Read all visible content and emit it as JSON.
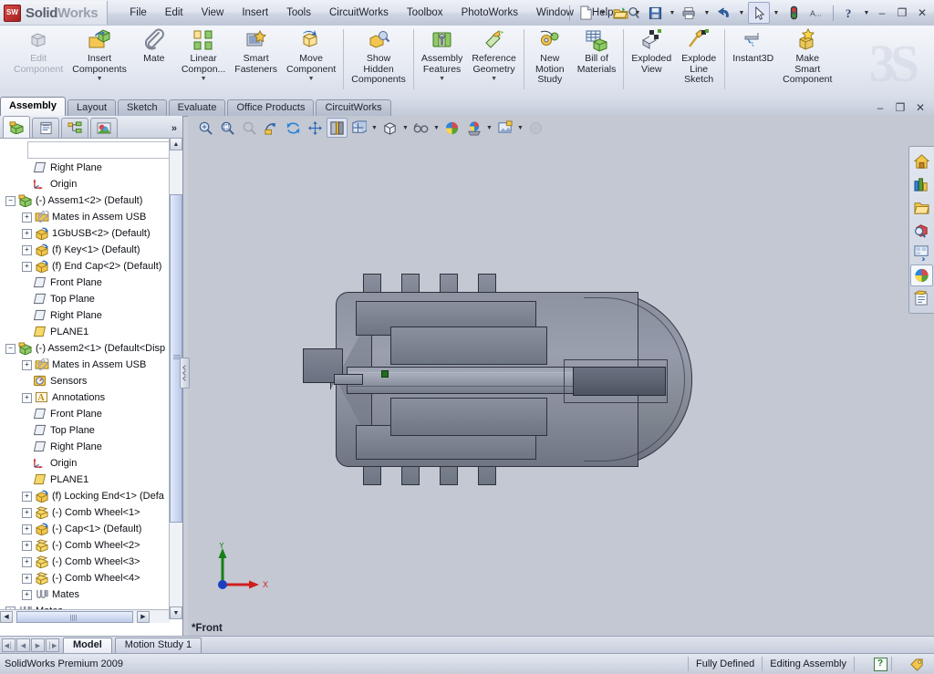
{
  "app": {
    "brand_bold": "Solid",
    "brand_light": "Works",
    "logo_glyph": "SW",
    "premium_label": "SolidWorks Premium 2009",
    "accent": "#c34040",
    "viewport_bg": "#c3c8d2"
  },
  "menu": {
    "items": [
      {
        "label": "File"
      },
      {
        "label": "Edit"
      },
      {
        "label": "View"
      },
      {
        "label": "Insert"
      },
      {
        "label": "Tools"
      },
      {
        "label": "CircuitWorks"
      },
      {
        "label": "Toolbox"
      },
      {
        "label": "PhotoWorks"
      },
      {
        "label": "Window"
      },
      {
        "label": "Help"
      }
    ],
    "search_icon": "magnifier-icon"
  },
  "quick_toolbar": {
    "buttons": [
      {
        "name": "new-document-button",
        "icon": "new-document-icon",
        "dropdown": true
      },
      {
        "name": "open-document-button",
        "icon": "open-folder-icon",
        "dropdown": true
      },
      {
        "name": "save-button",
        "icon": "floppy-disk-icon",
        "dropdown": true
      },
      {
        "name": "print-button",
        "icon": "printer-icon",
        "dropdown": true
      },
      {
        "name": "undo-button",
        "icon": "undo-arrow-icon",
        "dropdown": true
      },
      {
        "name": "select-button",
        "icon": "cursor-arrow-icon",
        "dropdown": true,
        "selected": true
      },
      {
        "name": "rebuild-button",
        "icon": "traffic-light-icon",
        "dropdown": false
      },
      {
        "name": "options-button",
        "icon": "options-gear-icon",
        "dropdown": false
      },
      {
        "name": "help-button",
        "icon": "question-mark-icon",
        "dropdown": true
      }
    ],
    "window_buttons": [
      {
        "name": "minimize-button",
        "glyph": "–"
      },
      {
        "name": "restore-button",
        "glyph": "❐"
      },
      {
        "name": "close-button",
        "glyph": "✕"
      }
    ]
  },
  "ribbon": {
    "watermark": "3S",
    "commands": [
      {
        "label": "Edit\nComponent",
        "name": "edit-component",
        "icon": "edit-component-icon",
        "disabled": true,
        "dropdown": false
      },
      {
        "label": "Insert\nComponents",
        "name": "insert-components",
        "icon": "insert-components-icon",
        "disabled": false,
        "dropdown": true
      },
      {
        "label": "Mate",
        "name": "mate",
        "icon": "paperclip-mate-icon",
        "disabled": false,
        "dropdown": false
      },
      {
        "label": "Linear\nCompon...",
        "name": "linear-component-pattern",
        "icon": "linear-pattern-icon",
        "disabled": false,
        "dropdown": true
      },
      {
        "label": "Smart\nFasteners",
        "name": "smart-fasteners",
        "icon": "smart-fasteners-icon",
        "disabled": false,
        "dropdown": false
      },
      {
        "label": "Move\nComponent",
        "name": "move-component",
        "icon": "move-component-icon",
        "disabled": false,
        "dropdown": true
      },
      {
        "label": "Show\nHidden\nComponents",
        "name": "show-hidden-components",
        "icon": "show-hidden-icon",
        "disabled": false,
        "dropdown": false
      },
      {
        "label": "Assembly\nFeatures",
        "name": "assembly-features",
        "icon": "assembly-features-icon",
        "disabled": false,
        "dropdown": true
      },
      {
        "label": "Reference\nGeometry",
        "name": "reference-geometry",
        "icon": "reference-geometry-icon",
        "disabled": false,
        "dropdown": true
      },
      {
        "label": "New\nMotion\nStudy",
        "name": "new-motion-study",
        "icon": "motion-study-icon",
        "disabled": false,
        "dropdown": false
      },
      {
        "label": "Bill of\nMaterials",
        "name": "bill-of-materials",
        "icon": "bom-table-icon",
        "disabled": false,
        "dropdown": false
      },
      {
        "label": "Exploded\nView",
        "name": "exploded-view",
        "icon": "exploded-view-icon",
        "disabled": false,
        "dropdown": false
      },
      {
        "label": "Explode\nLine\nSketch",
        "name": "explode-line-sketch",
        "icon": "explode-line-icon",
        "disabled": false,
        "dropdown": false
      },
      {
        "label": "Instant3D",
        "name": "instant3d",
        "icon": "instant3d-icon",
        "disabled": false,
        "dropdown": false
      },
      {
        "label": "Make\nSmart\nComponent",
        "name": "make-smart-component",
        "icon": "make-smart-component-icon",
        "disabled": false,
        "dropdown": false
      }
    ]
  },
  "command_tabs": {
    "items": [
      {
        "label": "Assembly",
        "active": true
      },
      {
        "label": "Layout",
        "active": false
      },
      {
        "label": "Sketch",
        "active": false
      },
      {
        "label": "Evaluate",
        "active": false
      },
      {
        "label": "Office Products",
        "active": false
      },
      {
        "label": "CircuitWorks",
        "active": false
      }
    ]
  },
  "feature_manager": {
    "tabs": [
      {
        "name": "feature-tree-tab",
        "icon": "feature-tree-icon",
        "active": true
      },
      {
        "name": "property-manager-tab",
        "icon": "property-manager-icon",
        "active": false
      },
      {
        "name": "configuration-manager-tab",
        "icon": "configuration-manager-icon",
        "active": false
      },
      {
        "name": "display-manager-tab",
        "icon": "display-manager-icon",
        "active": false
      }
    ],
    "more_glyph": "»",
    "filter_placeholder": "",
    "tree": [
      {
        "label": "Right Plane",
        "indent": 1,
        "expand": "none",
        "icon": "plane-icon"
      },
      {
        "label": "Origin",
        "indent": 1,
        "expand": "none",
        "icon": "origin-icon"
      },
      {
        "label": "(-) Assem1<2> (Default)",
        "indent": 0,
        "expand": "minus",
        "icon": "assembly-icon"
      },
      {
        "label": "Mates in Assem USB",
        "indent": 1,
        "expand": "plus",
        "icon": "mates-folder-icon"
      },
      {
        "label": "1GbUSB<2> (Default)",
        "indent": 1,
        "expand": "plus",
        "icon": "part-icon"
      },
      {
        "label": "(f) Key<1> (Default)",
        "indent": 1,
        "expand": "plus",
        "icon": "part-icon"
      },
      {
        "label": "(f) End Cap<2> (Default)",
        "indent": 1,
        "expand": "plus",
        "icon": "part-icon"
      },
      {
        "label": "Front Plane",
        "indent": 1,
        "expand": "none",
        "icon": "plane-icon"
      },
      {
        "label": "Top Plane",
        "indent": 1,
        "expand": "none",
        "icon": "plane-icon"
      },
      {
        "label": "Right Plane",
        "indent": 1,
        "expand": "none",
        "icon": "plane-icon"
      },
      {
        "label": "PLANE1",
        "indent": 1,
        "expand": "none",
        "icon": "plane-yellow-icon"
      },
      {
        "label": "(-) Assem2<1> (Default<Disp",
        "indent": 0,
        "expand": "minus",
        "icon": "assembly-icon"
      },
      {
        "label": "Mates in Assem USB",
        "indent": 1,
        "expand": "plus",
        "icon": "mates-folder-icon"
      },
      {
        "label": "Sensors",
        "indent": 1,
        "expand": "none",
        "icon": "sensors-icon"
      },
      {
        "label": "Annotations",
        "indent": 1,
        "expand": "plus",
        "icon": "annotations-icon"
      },
      {
        "label": "Front Plane",
        "indent": 1,
        "expand": "none",
        "icon": "plane-icon"
      },
      {
        "label": "Top Plane",
        "indent": 1,
        "expand": "none",
        "icon": "plane-icon"
      },
      {
        "label": "Right Plane",
        "indent": 1,
        "expand": "none",
        "icon": "plane-icon"
      },
      {
        "label": "Origin",
        "indent": 1,
        "expand": "none",
        "icon": "origin-icon"
      },
      {
        "label": "PLANE1",
        "indent": 1,
        "expand": "none",
        "icon": "plane-yellow-icon"
      },
      {
        "label": "(f) Locking End<1> (Defa",
        "indent": 1,
        "expand": "plus",
        "icon": "part-icon"
      },
      {
        "label": "(-) Comb Wheel<1>",
        "indent": 1,
        "expand": "plus",
        "icon": "part-yellow-icon"
      },
      {
        "label": "(-) Cap<1> (Default)",
        "indent": 1,
        "expand": "plus",
        "icon": "part-icon"
      },
      {
        "label": "(-) Comb Wheel<2>",
        "indent": 1,
        "expand": "plus",
        "icon": "part-yellow-icon"
      },
      {
        "label": "(-) Comb Wheel<3>",
        "indent": 1,
        "expand": "plus",
        "icon": "part-yellow-icon"
      },
      {
        "label": "(-) Comb Wheel<4>",
        "indent": 1,
        "expand": "plus",
        "icon": "part-yellow-icon"
      },
      {
        "label": "Mates",
        "indent": 1,
        "expand": "plus",
        "icon": "mates-icon"
      },
      {
        "label": "Mates",
        "indent": 0,
        "expand": "plus",
        "icon": "mates-icon"
      }
    ]
  },
  "view_toolbar": {
    "buttons": [
      {
        "name": "zoom-to-fit-button",
        "icon": "zoom-fit-icon",
        "disabled": false,
        "dropdown": false
      },
      {
        "name": "zoom-to-area-button",
        "icon": "zoom-area-icon",
        "disabled": false,
        "dropdown": false
      },
      {
        "name": "zoom-in-out-button",
        "icon": "zoom-inout-icon",
        "disabled": true,
        "dropdown": false
      },
      {
        "name": "rotate-view-button",
        "icon": "rotate-view-icon",
        "disabled": false,
        "dropdown": false
      },
      {
        "name": "previous-view-button",
        "icon": "previous-view-icon",
        "disabled": false,
        "dropdown": false
      },
      {
        "name": "pan-button",
        "icon": "pan-arrows-icon",
        "disabled": false,
        "dropdown": false
      },
      {
        "name": "section-view-button",
        "icon": "section-view-icon",
        "disabled": false,
        "dropdown": false,
        "selected": true
      },
      {
        "name": "view-orientation-button",
        "icon": "view-orientation-icon",
        "disabled": false,
        "dropdown": true
      },
      {
        "name": "display-style-button",
        "icon": "display-style-cube-icon",
        "disabled": false,
        "dropdown": true
      },
      {
        "name": "hide-show-items-button",
        "icon": "eyeglasses-icon",
        "disabled": false,
        "dropdown": true
      },
      {
        "name": "edit-appearance-button",
        "icon": "appearance-sphere-icon",
        "disabled": false,
        "dropdown": false
      },
      {
        "name": "apply-scene-button",
        "icon": "scene-icon",
        "disabled": false,
        "dropdown": true
      },
      {
        "name": "view-settings-button",
        "icon": "view-settings-icon",
        "disabled": false,
        "dropdown": true
      },
      {
        "name": "realview-button",
        "icon": "realview-sphere-icon",
        "disabled": true,
        "dropdown": false
      }
    ]
  },
  "doc_window_buttons": [
    {
      "name": "doc-minimize-button",
      "glyph": "–"
    },
    {
      "name": "doc-restore-button",
      "glyph": "❐"
    },
    {
      "name": "doc-close-button",
      "glyph": "✕"
    }
  ],
  "viewport": {
    "view_label": "*Front",
    "triad": {
      "x_label": "X",
      "y_label": "Y",
      "x_color": "#d01e1e",
      "y_color": "#158015",
      "origin_color": "#1a3fc4"
    }
  },
  "task_pane": {
    "buttons": [
      {
        "name": "design-library-home-button",
        "icon": "home-house-icon",
        "selected": false
      },
      {
        "name": "design-library-button",
        "icon": "design-library-icon",
        "selected": false
      },
      {
        "name": "file-explorer-button",
        "icon": "file-folder-icon",
        "selected": false
      },
      {
        "name": "search-button",
        "icon": "search-box-icon",
        "selected": false
      },
      {
        "name": "view-palette-button",
        "icon": "view-palette-icon",
        "selected": false
      },
      {
        "name": "appearances-scenes-button",
        "icon": "appearances-sphere-icon",
        "selected": true
      },
      {
        "name": "custom-properties-button",
        "icon": "custom-properties-icon",
        "selected": false
      }
    ]
  },
  "document_tabs": {
    "nav_buttons": [
      {
        "name": "first-tab-button",
        "glyph": "◀│"
      },
      {
        "name": "prev-tab-button",
        "glyph": "◀"
      },
      {
        "name": "next-tab-button",
        "glyph": "▶"
      },
      {
        "name": "last-tab-button",
        "glyph": "│▶"
      }
    ],
    "tabs": [
      {
        "label": "Model",
        "active": true
      },
      {
        "label": "Motion Study 1",
        "active": false
      }
    ]
  },
  "status_bar": {
    "left_text": "SolidWorks Premium 2009",
    "cells": [
      {
        "label": "Fully Defined",
        "name": "sketch-status"
      },
      {
        "label": "Editing Assembly",
        "name": "edit-mode-status"
      }
    ],
    "help_glyph": "?",
    "tag_icon": "tag-icon"
  }
}
